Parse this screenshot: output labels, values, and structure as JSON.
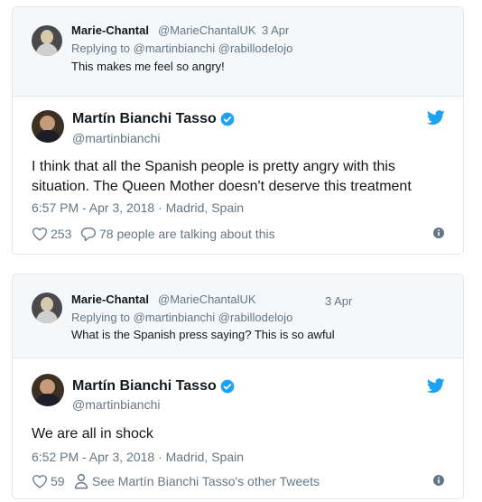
{
  "tweets": [
    {
      "reply": {
        "name": "Marie-Chantal",
        "handle": "@MarieChantalUK",
        "date": "3 Apr",
        "replying": "Replying to @martinbianchi @rabillodelojo",
        "text": "This makes me feel so angry!"
      },
      "main": {
        "name": "Martín Bianchi Tasso",
        "handle": "@martinbianchi",
        "text_line1": "I think that all the Spanish people is pretty angry with this",
        "text_line2": "situation. The Queen Mother doesn't deserve this treatment",
        "meta": "6:57 PM - Apr 3, 2018 · Madrid, Spain",
        "likes": "253",
        "talking": "78 people are talking about this"
      }
    },
    {
      "reply": {
        "name": "Marie-Chantal",
        "handle": "@MarieChantalUK",
        "date": "3 Apr",
        "replying": "Replying to @martinbianchi @rabillodelojo",
        "text": "What is the Spanish press saying? This is so awful"
      },
      "main": {
        "name": "Martín Bianchi Tasso",
        "handle": "@martinbianchi",
        "text_line1": "We are all in shock",
        "meta": "6:52 PM - Apr 3, 2018 · Madrid, Spain",
        "likes": "59",
        "other": "See Martín Bianchi Tasso's other Tweets"
      }
    }
  ],
  "icons": {
    "verified": "verified-badge-icon",
    "bird": "twitter-bird-icon",
    "like": "heart-icon",
    "reply": "speech-bubble-icon",
    "person": "person-icon",
    "info": "info-icon"
  },
  "colors": {
    "accent": "#1da1f2",
    "muted": "#657786",
    "text": "#14171a",
    "reply_bg": "#f5f8fa",
    "border": "#e1e8ed"
  }
}
